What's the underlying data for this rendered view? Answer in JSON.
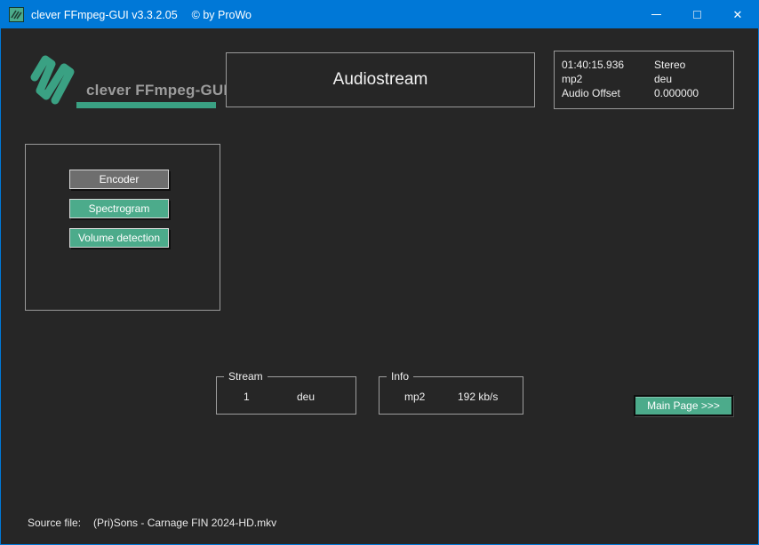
{
  "titlebar": {
    "app_title": "clever FFmpeg-GUI v3.3.2.05",
    "copyright": "© by ProWo",
    "close_glyph": "✕"
  },
  "header": {
    "logo_text": "clever FFmpeg-GUI",
    "page_title": "Audiostream"
  },
  "audio_info": {
    "rows": [
      {
        "left": "01:40:15.936",
        "right": "Stereo"
      },
      {
        "left": "mp2",
        "right": "deu"
      },
      {
        "left": "Audio Offset",
        "right": "0.000000"
      }
    ]
  },
  "tools": {
    "encoder": "Encoder",
    "spectrogram": "Spectrogram",
    "volume_detection": "Volume detection"
  },
  "stream_group": {
    "legend": "Stream",
    "number": "1",
    "language": "deu"
  },
  "info_group": {
    "legend": "Info",
    "codec": "mp2",
    "bitrate": "192 kb/s"
  },
  "navigation": {
    "main_page": "Main Page >>>"
  },
  "footer": {
    "label": "Source file:",
    "filename": "(Pri)Sons - Carnage FIN 2024-HD.mkv"
  },
  "colors": {
    "titlebar_blue": "#0078d7",
    "background": "#262626",
    "logo_teal": "#3aa183",
    "button_teal": "#4cab8b",
    "button_gray": "#6e6e6e",
    "box_border": "#9a9a9a",
    "text_light": "#f0f0f0",
    "logo_text_gray": "#9c9c9c"
  }
}
